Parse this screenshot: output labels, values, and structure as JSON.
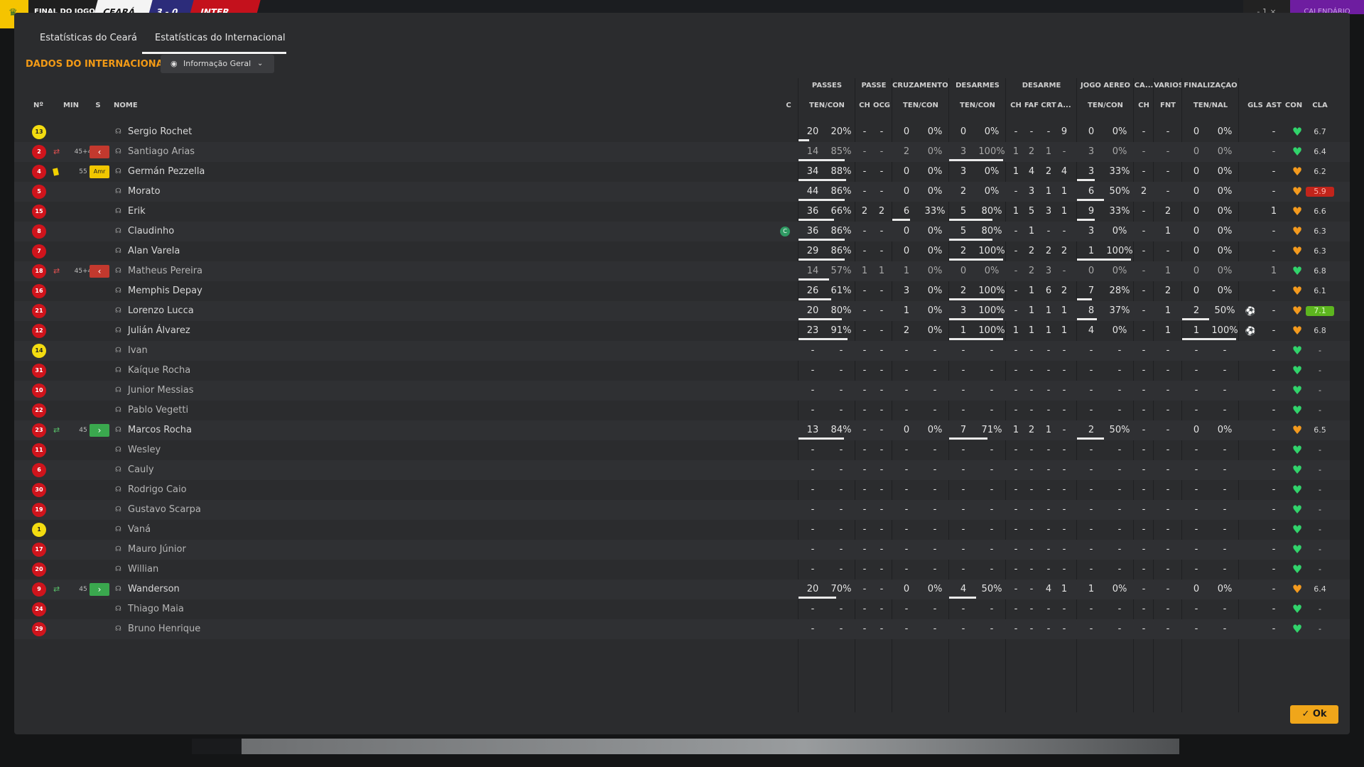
{
  "topbar": {
    "final_label": "FINAL DO JOGO",
    "home_team": "CEARÁ",
    "score": "3 - 0",
    "away_team": "INTER",
    "ctrl": "- 1",
    "close": "×",
    "right_label": "CALENDÁRIO"
  },
  "tabs": [
    {
      "label": "Estatísticas do Ceará"
    },
    {
      "label": "Estatísticas do Internacional"
    }
  ],
  "section_title": "DADOS DO INTERNACIONAL",
  "dropdown": {
    "label": "Informação Geral"
  },
  "groups": [
    "PASSES",
    "PASSE",
    "CRUZAMENTOS",
    "DESARMES",
    "DESARME",
    "JOGO AÉREO",
    "CA...",
    "VÁRIOS",
    "FINALIZAÇÃO"
  ],
  "columns": {
    "num": "Nº",
    "min": "MIN",
    "s": "S",
    "nome": "NOME",
    "c": "C",
    "passes": "TEN/CON",
    "passe_ch": "CH",
    "passe_ocg": "OCG",
    "cruz": "TEN/CON",
    "desarmes": "TEN/CON",
    "des_ch": "CH",
    "des_faf": "FAF",
    "des_crt": "CRT",
    "des_a": "A...",
    "aereo": "TEN/CON",
    "ca_ch": "CH",
    "varios": "FNT",
    "final": "TEN/NAL",
    "gls": "GLS",
    "ast": "AST",
    "con": "CON",
    "cla": "CLA"
  },
  "colors": {
    "accent": "#f29a16",
    "ok": "#f0a61a",
    "heart_green": "#31d36b",
    "heart_orange": "#f39a1e",
    "bad": "#c2241b",
    "good": "#5db51f"
  },
  "players": [
    {
      "num": "13",
      "gk": true,
      "sub": "",
      "min": "",
      "s": "",
      "name": "Sergio Rochet",
      "dim": false,
      "c": false,
      "p": [
        "20",
        "20%"
      ],
      "pch": "-",
      "pocg": "-",
      "cz": [
        "0",
        "0%"
      ],
      "ds": [
        "0",
        "0%"
      ],
      "dch": "-",
      "dfaf": "-",
      "dcrt": "-",
      "da": "9",
      "ae": [
        "0",
        "0%"
      ],
      "cach": "-",
      "fnt": "-",
      "fn": [
        "0",
        "0%"
      ],
      "gls": "",
      "ast": "-",
      "heart": "green",
      "cla": "6.7",
      "cla_state": "",
      "bars": {
        "p": 0.2
      }
    },
    {
      "num": "2",
      "gk": false,
      "sub": "swap",
      "min": "45+4",
      "s": "out",
      "name": "Santiago Arias",
      "dim": true,
      "c": false,
      "p": [
        "14",
        "85%"
      ],
      "pch": "-",
      "pocg": "-",
      "cz": [
        "2",
        "0%"
      ],
      "ds": [
        "3",
        "100%"
      ],
      "dch": "1",
      "dfaf": "2",
      "dcrt": "1",
      "da": "-",
      "ae": [
        "3",
        "0%"
      ],
      "cach": "-",
      "fnt": "-",
      "fn": [
        "0",
        "0%"
      ],
      "gls": "",
      "ast": "-",
      "heart": "green",
      "cla": "6.4",
      "cla_state": "",
      "bars": {
        "p": 0.85,
        "ds": 1
      }
    },
    {
      "num": "4",
      "gk": false,
      "sub": "yellow",
      "min": "55",
      "s": "amr",
      "name": "Germán Pezzella",
      "dim": false,
      "c": false,
      "p": [
        "34",
        "88%"
      ],
      "pch": "-",
      "pocg": "-",
      "cz": [
        "0",
        "0%"
      ],
      "ds": [
        "3",
        "0%"
      ],
      "dch": "1",
      "dfaf": "4",
      "dcrt": "2",
      "da": "4",
      "ae": [
        "3",
        "33%"
      ],
      "cach": "-",
      "fnt": "-",
      "fn": [
        "0",
        "0%"
      ],
      "gls": "",
      "ast": "-",
      "heart": "orange",
      "cla": "6.2",
      "cla_state": "",
      "bars": {
        "p": 0.88,
        "ae": 0.33
      }
    },
    {
      "num": "5",
      "gk": false,
      "sub": "",
      "min": "",
      "s": "",
      "name": "Morato",
      "dim": false,
      "c": false,
      "p": [
        "44",
        "86%"
      ],
      "pch": "-",
      "pocg": "-",
      "cz": [
        "0",
        "0%"
      ],
      "ds": [
        "2",
        "0%"
      ],
      "dch": "-",
      "dfaf": "3",
      "dcrt": "1",
      "da": "1",
      "ae": [
        "6",
        "50%"
      ],
      "cach": "2",
      "fnt": "-",
      "fn": [
        "0",
        "0%"
      ],
      "gls": "",
      "ast": "-",
      "heart": "orange",
      "cla": "5.9",
      "cla_state": "bad",
      "bars": {
        "p": 0.86,
        "ae": 0.5
      }
    },
    {
      "num": "15",
      "gk": false,
      "sub": "",
      "min": "",
      "s": "",
      "name": "Erik",
      "dim": false,
      "c": false,
      "p": [
        "36",
        "66%"
      ],
      "pch": "2",
      "pocg": "2",
      "cz": [
        "6",
        "33%"
      ],
      "ds": [
        "5",
        "80%"
      ],
      "dch": "1",
      "dfaf": "5",
      "dcrt": "3",
      "da": "1",
      "ae": [
        "9",
        "33%"
      ],
      "cach": "-",
      "fnt": "2",
      "fn": [
        "0",
        "0%"
      ],
      "gls": "",
      "ast": "1",
      "heart": "orange",
      "cla": "6.6",
      "cla_state": "",
      "bars": {
        "p": 0.66,
        "cz": 0.33,
        "ds": 0.8,
        "ae": 0.33
      }
    },
    {
      "num": "8",
      "gk": false,
      "sub": "",
      "min": "",
      "s": "",
      "name": "Claudinho",
      "dim": false,
      "c": true,
      "p": [
        "36",
        "86%"
      ],
      "pch": "-",
      "pocg": "-",
      "cz": [
        "0",
        "0%"
      ],
      "ds": [
        "5",
        "80%"
      ],
      "dch": "-",
      "dfaf": "1",
      "dcrt": "-",
      "da": "-",
      "ae": [
        "3",
        "0%"
      ],
      "cach": "-",
      "fnt": "1",
      "fn": [
        "0",
        "0%"
      ],
      "gls": "",
      "ast": "-",
      "heart": "orange",
      "cla": "6.3",
      "cla_state": "",
      "bars": {
        "p": 0.86,
        "ds": 0.8
      }
    },
    {
      "num": "7",
      "gk": false,
      "sub": "",
      "min": "",
      "s": "",
      "name": "Alan Varela",
      "dim": false,
      "c": false,
      "p": [
        "29",
        "86%"
      ],
      "pch": "-",
      "pocg": "-",
      "cz": [
        "0",
        "0%"
      ],
      "ds": [
        "2",
        "100%"
      ],
      "dch": "-",
      "dfaf": "2",
      "dcrt": "2",
      "da": "2",
      "ae": [
        "1",
        "100%"
      ],
      "cach": "-",
      "fnt": "-",
      "fn": [
        "0",
        "0%"
      ],
      "gls": "",
      "ast": "-",
      "heart": "orange",
      "cla": "6.3",
      "cla_state": "",
      "bars": {
        "p": 0.86,
        "ds": 1,
        "ae": 1
      }
    },
    {
      "num": "18",
      "gk": false,
      "sub": "swap",
      "min": "45+4",
      "s": "out",
      "name": "Matheus Pereira",
      "dim": true,
      "c": false,
      "p": [
        "14",
        "57%"
      ],
      "pch": "1",
      "pocg": "1",
      "cz": [
        "1",
        "0%"
      ],
      "ds": [
        "0",
        "0%"
      ],
      "dch": "-",
      "dfaf": "2",
      "dcrt": "3",
      "da": "-",
      "ae": [
        "0",
        "0%"
      ],
      "cach": "-",
      "fnt": "1",
      "fn": [
        "0",
        "0%"
      ],
      "gls": "",
      "ast": "1",
      "heart": "green",
      "cla": "6.8",
      "cla_state": "",
      "bars": {
        "p": 0.57
      }
    },
    {
      "num": "16",
      "gk": false,
      "sub": "",
      "min": "",
      "s": "",
      "name": "Memphis Depay",
      "dim": false,
      "c": false,
      "p": [
        "26",
        "61%"
      ],
      "pch": "-",
      "pocg": "-",
      "cz": [
        "3",
        "0%"
      ],
      "ds": [
        "2",
        "100%"
      ],
      "dch": "-",
      "dfaf": "1",
      "dcrt": "6",
      "da": "2",
      "ae": [
        "7",
        "28%"
      ],
      "cach": "-",
      "fnt": "2",
      "fn": [
        "0",
        "0%"
      ],
      "gls": "",
      "ast": "-",
      "heart": "orange",
      "cla": "6.1",
      "cla_state": "",
      "bars": {
        "p": 0.61,
        "ds": 1,
        "ae": 0.28
      }
    },
    {
      "num": "21",
      "gk": false,
      "sub": "",
      "min": "",
      "s": "",
      "name": "Lorenzo Lucca",
      "dim": false,
      "c": false,
      "p": [
        "20",
        "80%"
      ],
      "pch": "-",
      "pocg": "-",
      "cz": [
        "1",
        "0%"
      ],
      "ds": [
        "3",
        "100%"
      ],
      "dch": "-",
      "dfaf": "1",
      "dcrt": "1",
      "da": "1",
      "ae": [
        "8",
        "37%"
      ],
      "cach": "-",
      "fnt": "1",
      "fn": [
        "2",
        "50%"
      ],
      "gls": "ball",
      "ast": "-",
      "heart": "orange",
      "cla": "7.1",
      "cla_state": "good",
      "bars": {
        "p": 0.8,
        "ds": 1,
        "ae": 0.37,
        "fn": 0.5
      }
    },
    {
      "num": "12",
      "gk": false,
      "sub": "",
      "min": "",
      "s": "",
      "name": "Julián Álvarez",
      "dim": false,
      "c": false,
      "p": [
        "23",
        "91%"
      ],
      "pch": "-",
      "pocg": "-",
      "cz": [
        "2",
        "0%"
      ],
      "ds": [
        "1",
        "100%"
      ],
      "dch": "1",
      "dfaf": "1",
      "dcrt": "1",
      "da": "1",
      "ae": [
        "4",
        "0%"
      ],
      "cach": "-",
      "fnt": "1",
      "fn": [
        "1",
        "100%"
      ],
      "gls": "ball",
      "ast": "-",
      "heart": "orange",
      "cla": "6.8",
      "cla_state": "",
      "bars": {
        "p": 0.91,
        "ds": 1,
        "fn": 1
      }
    },
    {
      "num": "14",
      "gk": true,
      "sub": "",
      "min": "",
      "s": "",
      "name": "Ivan",
      "dim": true,
      "c": false,
      "empty": true,
      "heart": "green",
      "cla": "-",
      "cla_state": ""
    },
    {
      "num": "31",
      "gk": false,
      "sub": "",
      "min": "",
      "s": "",
      "name": "Kaíque Rocha",
      "dim": true,
      "c": false,
      "empty": true,
      "heart": "green",
      "cla": "-",
      "cla_state": ""
    },
    {
      "num": "10",
      "gk": false,
      "sub": "",
      "min": "",
      "s": "",
      "name": "Junior Messias",
      "dim": true,
      "c": false,
      "empty": true,
      "heart": "green",
      "cla": "-",
      "cla_state": ""
    },
    {
      "num": "22",
      "gk": false,
      "sub": "",
      "min": "",
      "s": "",
      "name": "Pablo Vegetti",
      "dim": true,
      "c": false,
      "empty": true,
      "heart": "green",
      "cla": "-",
      "cla_state": ""
    },
    {
      "num": "23",
      "gk": false,
      "sub": "swapin",
      "min": "45",
      "s": "in",
      "name": "Marcos Rocha",
      "dim": false,
      "c": false,
      "p": [
        "13",
        "84%"
      ],
      "pch": "-",
      "pocg": "-",
      "cz": [
        "0",
        "0%"
      ],
      "ds": [
        "7",
        "71%"
      ],
      "dch": "1",
      "dfaf": "2",
      "dcrt": "1",
      "da": "-",
      "ae": [
        "2",
        "50%"
      ],
      "cach": "-",
      "fnt": "-",
      "fn": [
        "0",
        "0%"
      ],
      "gls": "",
      "ast": "-",
      "heart": "orange",
      "cla": "6.5",
      "cla_state": "",
      "bars": {
        "p": 0.84,
        "ds": 0.71,
        "ae": 0.5
      }
    },
    {
      "num": "11",
      "gk": false,
      "sub": "",
      "min": "",
      "s": "",
      "name": "Wesley",
      "dim": true,
      "c": false,
      "empty": true,
      "heart": "green",
      "cla": "-",
      "cla_state": ""
    },
    {
      "num": "6",
      "gk": false,
      "sub": "",
      "min": "",
      "s": "",
      "name": "Cauly",
      "dim": true,
      "c": false,
      "empty": true,
      "heart": "green",
      "cla": "-",
      "cla_state": ""
    },
    {
      "num": "30",
      "gk": false,
      "sub": "",
      "min": "",
      "s": "",
      "name": "Rodrigo Caio",
      "dim": true,
      "c": false,
      "empty": true,
      "heart": "green",
      "cla": "-",
      "cla_state": ""
    },
    {
      "num": "19",
      "gk": false,
      "sub": "",
      "min": "",
      "s": "",
      "name": "Gustavo Scarpa",
      "dim": true,
      "c": false,
      "empty": true,
      "heart": "green",
      "cla": "-",
      "cla_state": ""
    },
    {
      "num": "1",
      "gk": true,
      "sub": "",
      "min": "",
      "s": "",
      "name": "Vaná",
      "dim": true,
      "c": false,
      "empty": true,
      "heart": "green",
      "cla": "-",
      "cla_state": ""
    },
    {
      "num": "17",
      "gk": false,
      "sub": "",
      "min": "",
      "s": "",
      "name": "Mauro Júnior",
      "dim": true,
      "c": false,
      "empty": true,
      "heart": "green",
      "cla": "-",
      "cla_state": ""
    },
    {
      "num": "20",
      "gk": false,
      "sub": "",
      "min": "",
      "s": "",
      "name": "Willian",
      "dim": true,
      "c": false,
      "empty": true,
      "heart": "green",
      "cla": "-",
      "cla_state": ""
    },
    {
      "num": "9",
      "gk": false,
      "sub": "swapin",
      "min": "45",
      "s": "in",
      "name": "Wanderson",
      "dim": false,
      "c": false,
      "p": [
        "20",
        "70%"
      ],
      "pch": "-",
      "pocg": "-",
      "cz": [
        "0",
        "0%"
      ],
      "ds": [
        "4",
        "50%"
      ],
      "dch": "-",
      "dfaf": "-",
      "dcrt": "4",
      "da": "1",
      "ae": [
        "1",
        "0%"
      ],
      "cach": "-",
      "fnt": "-",
      "fn": [
        "0",
        "0%"
      ],
      "gls": "",
      "ast": "-",
      "heart": "orange",
      "cla": "6.4",
      "cla_state": "",
      "bars": {
        "p": 0.7,
        "ds": 0.5
      }
    },
    {
      "num": "24",
      "gk": false,
      "sub": "",
      "min": "",
      "s": "",
      "name": "Thiago Maia",
      "dim": true,
      "c": false,
      "empty": true,
      "heart": "green",
      "cla": "-",
      "cla_state": ""
    },
    {
      "num": "29",
      "gk": false,
      "sub": "",
      "min": "",
      "s": "",
      "name": "Bruno Henrique",
      "dim": true,
      "c": false,
      "empty": true,
      "heart": "green",
      "cla": "-",
      "cla_state": ""
    }
  ],
  "ok_button": "Ok",
  "icons": {
    "amr_label": "Amr",
    "c_badge": "C",
    "out_arrow": "‹",
    "in_arrow": "›"
  }
}
